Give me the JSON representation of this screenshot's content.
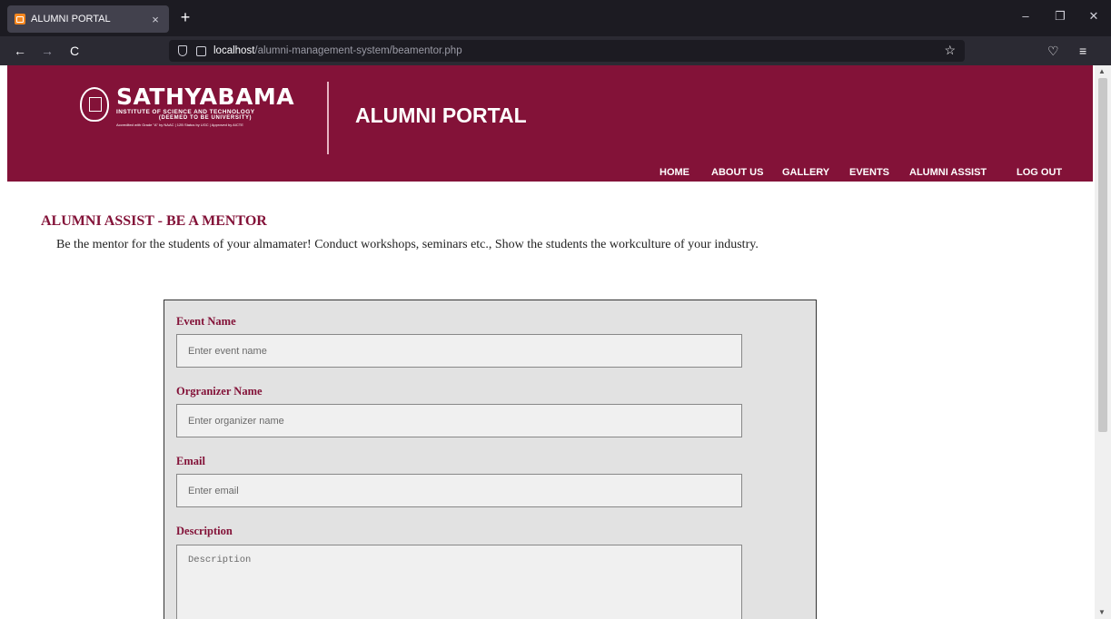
{
  "browser": {
    "tab_title": "ALUMNI PORTAL",
    "tab_close": "×",
    "new_tab": "+",
    "url_host": "localhost",
    "url_path": "/alumni-management-system/beamentor.php",
    "back": "←",
    "forward": "→",
    "reload": "C",
    "bookmark_star": "☆",
    "pocket": "♡",
    "menu": "≡",
    "minimize": "–",
    "restore": "❐",
    "close": "✕"
  },
  "header": {
    "logo": {
      "name": "SATHYABAMA",
      "sub1": "INSTITUTE OF SCIENCE AND TECHNOLOGY",
      "sub2": "(DEEMED TO BE UNIVERSITY)",
      "sub3": "Accredited with Grade \"A\" by NAAC | 12B Status by UGC | Approved by AICTE"
    },
    "title": "ALUMNI PORTAL",
    "menu": [
      "HOME",
      "ABOUT US",
      "GALLERY",
      "EVENTS",
      "ALUMNI ASSIST",
      "LOG OUT"
    ]
  },
  "section": {
    "title": "ALUMNI ASSIST - BE A MENTOR",
    "description": "Be the mentor for the students of your almamater! Conduct workshops, seminars etc., Show the students the workculture of your industry."
  },
  "form": {
    "fields": [
      {
        "label": "Event Name",
        "placeholder": "Enter event name",
        "value": ""
      },
      {
        "label": "Orgranizer Name",
        "placeholder": "Enter organizer name",
        "value": ""
      },
      {
        "label": "Email",
        "placeholder": "Enter email",
        "value": ""
      },
      {
        "label": "Description",
        "placeholder": "Description",
        "value": ""
      }
    ]
  },
  "colors": {
    "brand": "#831238",
    "form_background": "#e2e2e2"
  }
}
